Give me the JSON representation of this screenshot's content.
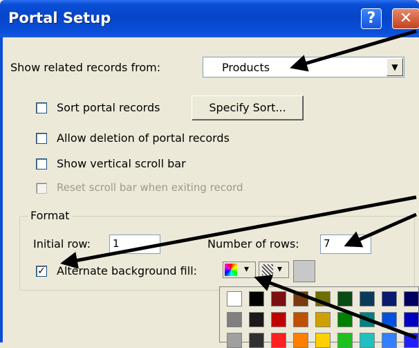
{
  "window": {
    "title": "Portal Setup",
    "help_glyph": "?",
    "close_glyph": "✕"
  },
  "related": {
    "label": "Show related records from:",
    "value": "Products",
    "arrow_glyph": "▼"
  },
  "options": {
    "sort_label": "Sort portal records",
    "sort_checked": false,
    "specify_sort_label": "Specify Sort...",
    "allow_deletion_label": "Allow deletion of portal records",
    "allow_deletion_checked": false,
    "scroll_bar_label": "Show vertical scroll bar",
    "scroll_bar_checked": false,
    "reset_scroll_label": "Reset scroll bar when exiting record",
    "reset_scroll_checked": false,
    "reset_scroll_enabled": false
  },
  "format": {
    "legend": "Format",
    "initial_row_label": "Initial row:",
    "initial_row_value": "1",
    "num_rows_label": "Number of rows:",
    "num_rows_value": "7",
    "alt_fill_label": "Alternate background fill:",
    "alt_fill_checked": true,
    "check_glyph": "✓",
    "dropdown_glyph": "▾"
  },
  "palette": {
    "rows": [
      [
        "#ffffff",
        "#000000",
        "#7a1010",
        "#7a3a10",
        "#6e6e00",
        "#0a4a14",
        "#0a3a5a",
        "#0a1a6e",
        "#000060"
      ],
      [
        "#808080",
        "#1a1a1a",
        "#c00000",
        "#c05000",
        "#d0a000",
        "#008000",
        "#008080",
        "#0050e0",
        "#0000c0"
      ],
      [
        "#a0a0a0",
        "#303030",
        "#ff2020",
        "#ff7f00",
        "#ffd000",
        "#20c020",
        "#20c0c0",
        "#3080ff",
        "#2020ff"
      ]
    ]
  },
  "colors": {
    "titlebar": "#0645c9",
    "dialog_bg": "#ece9d8",
    "arrow": "#000000"
  }
}
